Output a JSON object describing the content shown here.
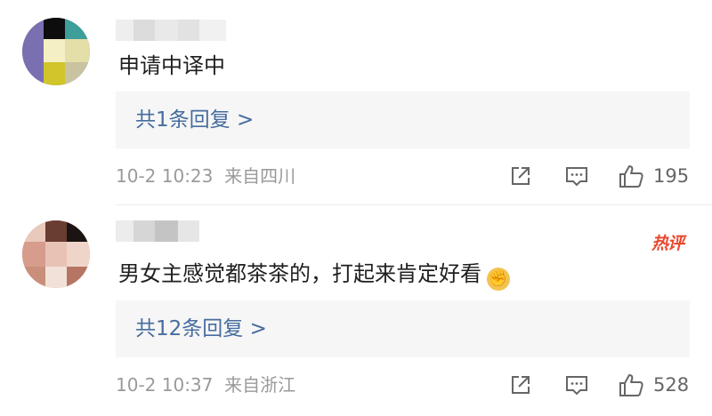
{
  "comments": [
    {
      "text": "申请中译中",
      "reply_link": "共1条回复 >",
      "time": "10-2 10:23",
      "location": "来自四川",
      "like_count": "195",
      "hot": false,
      "avatar_colors": [
        "#7a6fb0",
        "#0d0d0d",
        "#3d9e9a",
        "#f4f0c4",
        "#c9c3a1",
        "#e4dfa8",
        "#d1c52b",
        "#7d7bb5"
      ]
    },
    {
      "text": "男女主感觉都茶茶的，打起来肯定好看",
      "reply_link": "共12条回复 >",
      "time": "10-2 10:37",
      "location": "来自浙江",
      "like_count": "528",
      "hot": true,
      "hot_label": "热评",
      "emoji": "punch-emoji",
      "avatar_colors": [
        "#b67563",
        "#6a3d31",
        "#1b1412",
        "#d69c8c",
        "#e8c3b5",
        "#efd5c9",
        "#c98f7a",
        "#f2e1d8"
      ]
    }
  ],
  "colors": {
    "link": "#466c9e",
    "reply_bg": "#f6f6f6",
    "meta": "#9a9a9a",
    "hot": "#e8492f"
  },
  "icons": [
    "share-icon",
    "comment-icon",
    "like-icon"
  ]
}
